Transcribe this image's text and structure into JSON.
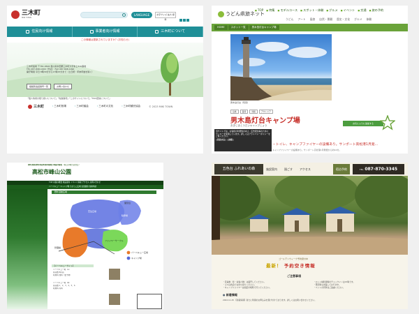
{
  "panel1": {
    "logo_name": "三木町",
    "logo_sub": "MIKI TOWN",
    "language_button": "LANGUAGE",
    "font_size_label": "文字サイズ 拡大 標準",
    "nav": [
      "住民向け情報",
      "事業者向け情報",
      "三木町について"
    ],
    "notice": "この情報は更新されていますか？(お知らせ)",
    "info_lines": [
      "三木町役場 〒761-0692 香川県木田郡三木町大字氷上310番地",
      "TEL 087-898-1000（代表）  FAX 087-898-1990",
      "開庁時間 平日 8時30分から17時15分まで（土日祝・年末年始を除く）"
    ],
    "buttons": [
      "組織別電話番号一覧",
      "お問い合わせ"
    ],
    "policy": "「個人情報の取り扱いについて」「免責事項」「このサイトについて」「RSS配信について」",
    "footer_links": [
      "三木町役場",
      "三木町議会",
      "三木町の文化",
      "三木町観光協会"
    ],
    "copyright": "© 2023 MIKI TOWN"
  },
  "panel2": {
    "logo": "うどん県旅ネット",
    "main_nav": [
      "TOP",
      "特集",
      "モデルコース",
      "スポット・体験",
      "グルメ",
      "イベント",
      "交通",
      "旅の予約"
    ],
    "sub_nav": [
      "うどん",
      "アート",
      "島旅",
      "自然・景観",
      "歴史・文化",
      "グルメ",
      "体験"
    ],
    "breadcrumb": [
      "HOME",
      "スポット一覧",
      "男木島灯台キャンプ場"
    ],
    "caption": "男木島灯台（写真）",
    "tags": [
      "島旅",
      "自然",
      "景観",
      "アウトドア"
    ],
    "title": "男木島灯台キャンプ場",
    "subtitle": "おぎじまとうだいキャンプじょう",
    "popup": "当サイトでは、お客様の利便性の向上、広告配信等のためにクッキーを使用しています。詳しくはプライバシーポリシーをご覧ください。",
    "popup_buttons": [
      "同意する",
      "詳細"
    ],
    "description": "・トイレ、キャンプファイヤーの設備あり。サンポート高松港1月発...",
    "description2": "キャンプファイヤーの設備あり。サンポート高松港1月発便から約40分。",
    "favorite": "お気に入りに追加する"
  },
  "panel3": {
    "header_small": "香川県高松市 峰山公園 休園日 毎週月曜日（祝日の場合は翌日）",
    "title": "高松市峰山公園",
    "header_right": "TEL 087-861-5225  FAX 087-862-3115",
    "nav1": "TOP  公園の概要  施設案内  イベント情報  アクセス  お問い合わせ",
    "nav2": "バーベキュー  キャンプ場  ちびっこ広場  自然観察  各種申請",
    "section": "野外活動広場",
    "map_legend": [
      "バーベキュー広場",
      "キャンプ場"
    ],
    "map_labels": [
      "芝生広場",
      "展望台",
      "駐車場",
      "ファイヤーサークル",
      "管理棟"
    ],
    "list_heading": "【バーベキューサイト】",
    "list_lines": [
      "バーベキュー場（A）",
      "区画数 8区画",
      "利用料 無料（要予約）",
      "バーベキュー場（B）",
      "区画数 1、2、3、4、5、6",
      "利用料 有料"
    ]
  },
  "panel4": {
    "logo": "五色台 ふれあいの森",
    "nav": [
      "施設案内",
      "過ごす",
      "アクセス"
    ],
    "reserve": "宿泊予約",
    "tel_label": "TEL",
    "tel": "087-870-3345",
    "ribbon": "ゴールデンウィーク予約受付中",
    "vacancy": [
      "最新！",
      "予約空き情報"
    ],
    "notes_heading": "ご注意事項",
    "notes_left": [
      "・定員数（車・収容人数）は厳守してください。",
      "・ゴミは各自でお持ち帰りください。",
      "・キャンプファイヤーは指定の場所で行ってください。"
    ],
    "notes_right": [
      "・ロッジ棟利用時のチェックインは15時です。",
      "・雨天時も営業しております。",
      "・ペットの同伴はご遠慮ください。"
    ],
    "news_heading": "新着情報",
    "news_line": "2022.11.25 【新着情報】新たに利用のお申込みを受け付けております。詳しくはお問い合わせください。"
  }
}
